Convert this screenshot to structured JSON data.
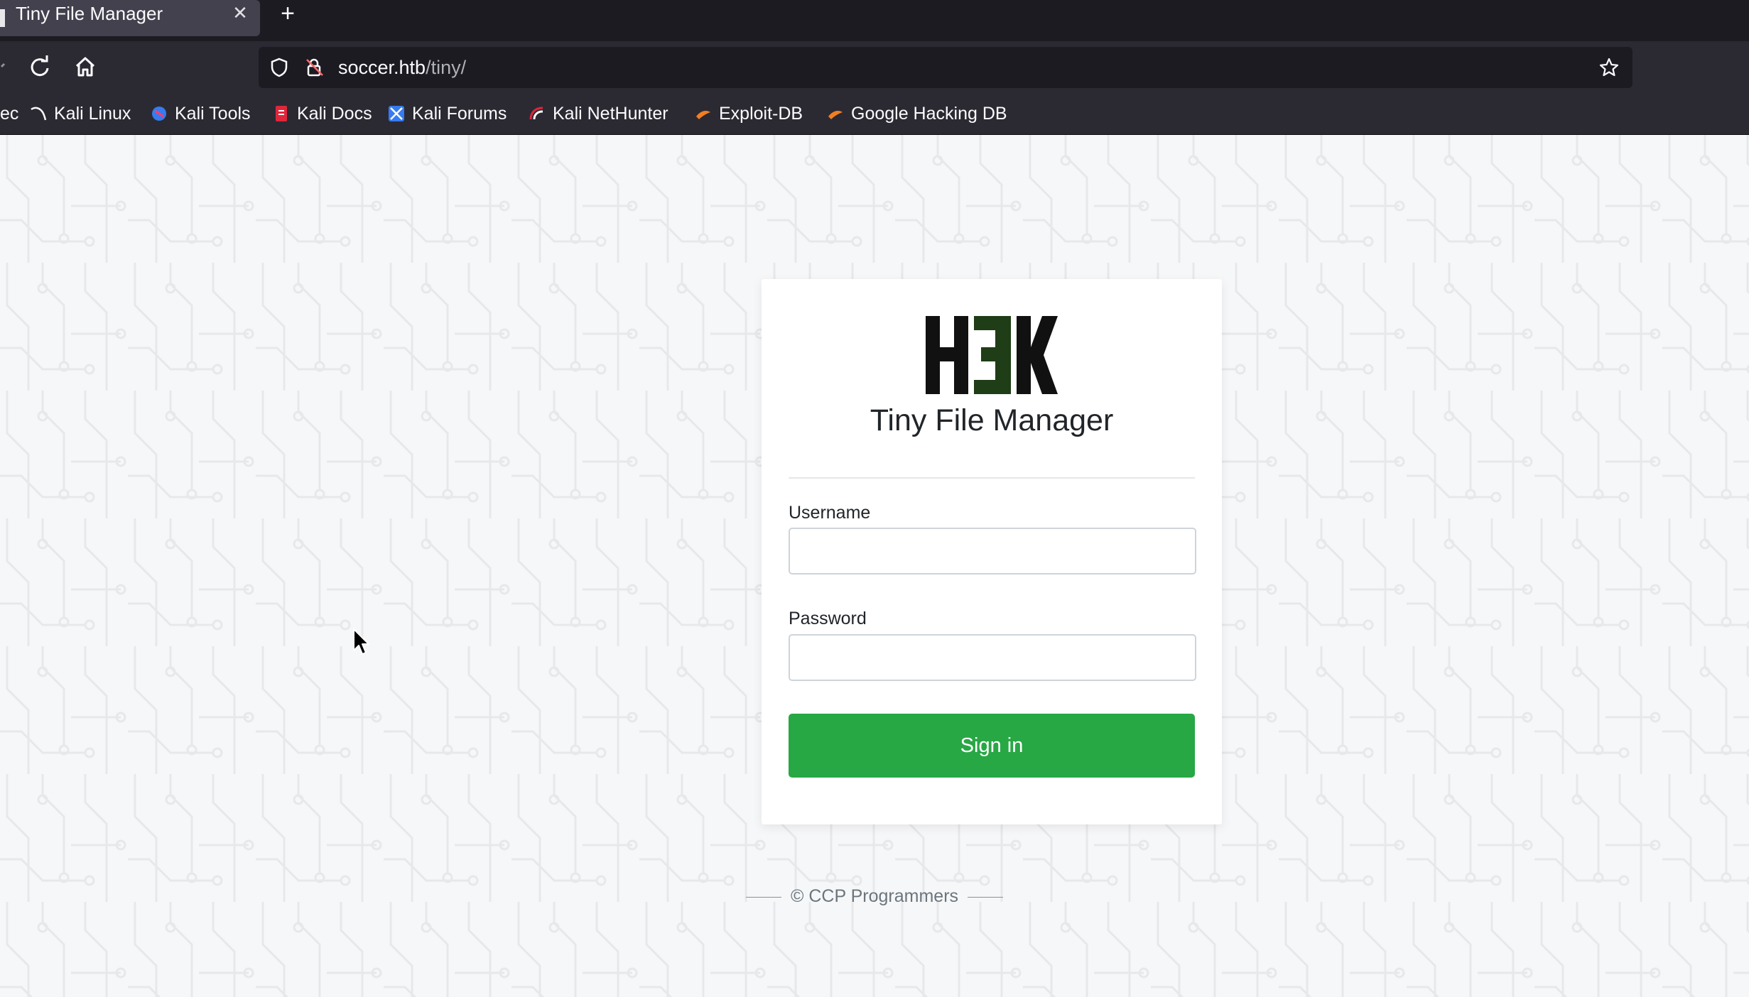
{
  "browser": {
    "tab_title": "Tiny File Manager",
    "url_host": "soccer.htb",
    "url_path": "/tiny/",
    "bookmarks": [
      {
        "label": "ec",
        "icon": "partial-bookmark-icon"
      },
      {
        "label": "Kali Linux",
        "icon": "kali-dragon-icon"
      },
      {
        "label": "Kali Tools",
        "icon": "kali-tools-icon"
      },
      {
        "label": "Kali Docs",
        "icon": "kali-docs-icon"
      },
      {
        "label": "Kali Forums",
        "icon": "kali-forums-icon"
      },
      {
        "label": "Kali NetHunter",
        "icon": "kali-nethunter-icon"
      },
      {
        "label": "Exploit-DB",
        "icon": "exploit-db-icon"
      },
      {
        "label": "Google Hacking DB",
        "icon": "google-hacking-db-icon"
      }
    ]
  },
  "login": {
    "logo_text": "H3K",
    "title": "Tiny File Manager",
    "username_label": "Username",
    "username_value": "",
    "password_label": "Password",
    "password_value": "",
    "signin_label": "Sign in"
  },
  "footer": {
    "text": "© CCP Programmers"
  },
  "colors": {
    "accent_green": "#28a745",
    "logo_green": "#1f3d16",
    "background": "#f6f7f8"
  }
}
